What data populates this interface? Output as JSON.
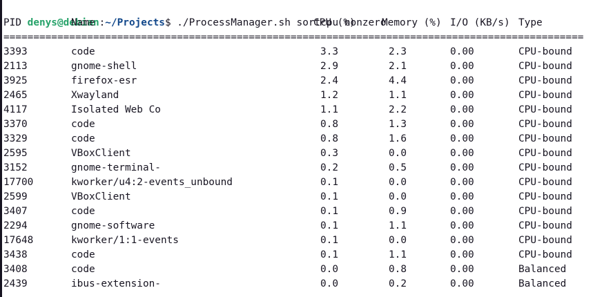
{
  "prompt": {
    "user_host": "denys@debian",
    "colon": ":",
    "path": "~/Projects",
    "symbol": "$",
    "command": " ./ProcessManager.sh sortcpu nonzero"
  },
  "table": {
    "headers": {
      "pid": "PID",
      "name": "Name",
      "cpu": "CPU (%)",
      "memory": "Memory (%)",
      "io": "I/O (KB/s)",
      "type": "Type"
    },
    "separator": "=================================================================================================",
    "rows": [
      {
        "pid": "3393",
        "name": "code",
        "cpu": "3.3",
        "mem": "2.3",
        "io": "0.00",
        "type": "CPU-bound"
      },
      {
        "pid": "2113",
        "name": "gnome-shell",
        "cpu": "2.9",
        "mem": "2.1",
        "io": "0.00",
        "type": "CPU-bound"
      },
      {
        "pid": "3925",
        "name": "firefox-esr",
        "cpu": "2.4",
        "mem": "4.4",
        "io": "0.00",
        "type": "CPU-bound"
      },
      {
        "pid": "2465",
        "name": "Xwayland",
        "cpu": "1.2",
        "mem": "1.1",
        "io": "0.00",
        "type": "CPU-bound"
      },
      {
        "pid": "4117",
        "name": "Isolated Web Co",
        "cpu": "1.1",
        "mem": "2.2",
        "io": "0.00",
        "type": "CPU-bound"
      },
      {
        "pid": "3370",
        "name": "code",
        "cpu": "0.8",
        "mem": "1.3",
        "io": "0.00",
        "type": "CPU-bound"
      },
      {
        "pid": "3329",
        "name": "code",
        "cpu": "0.8",
        "mem": "1.6",
        "io": "0.00",
        "type": "CPU-bound"
      },
      {
        "pid": "2595",
        "name": "VBoxClient",
        "cpu": "0.3",
        "mem": "0.0",
        "io": "0.00",
        "type": "CPU-bound"
      },
      {
        "pid": "3152",
        "name": "gnome-terminal-",
        "cpu": "0.2",
        "mem": "0.5",
        "io": "0.00",
        "type": "CPU-bound"
      },
      {
        "pid": "17700",
        "name": "kworker/u4:2-events_unbound",
        "cpu": "0.1",
        "mem": "0.0",
        "io": "0.00",
        "type": "CPU-bound"
      },
      {
        "pid": "2599",
        "name": "VBoxClient",
        "cpu": "0.1",
        "mem": "0.0",
        "io": "0.00",
        "type": "CPU-bound"
      },
      {
        "pid": "3407",
        "name": "code",
        "cpu": "0.1",
        "mem": "0.9",
        "io": "0.00",
        "type": "CPU-bound"
      },
      {
        "pid": "2294",
        "name": "gnome-software",
        "cpu": "0.1",
        "mem": "1.1",
        "io": "0.00",
        "type": "CPU-bound"
      },
      {
        "pid": "17648",
        "name": "kworker/1:1-events",
        "cpu": "0.1",
        "mem": "0.0",
        "io": "0.00",
        "type": "CPU-bound"
      },
      {
        "pid": "3438",
        "name": "code",
        "cpu": "0.1",
        "mem": "1.1",
        "io": "0.00",
        "type": "CPU-bound"
      },
      {
        "pid": "3408",
        "name": "code",
        "cpu": "0.0",
        "mem": "0.8",
        "io": "0.00",
        "type": "Balanced"
      },
      {
        "pid": "2439",
        "name": "ibus-extension-",
        "cpu": "0.0",
        "mem": "0.2",
        "io": "0.00",
        "type": "Balanced"
      }
    ]
  },
  "colors": {
    "background": "#ffffff",
    "foreground": "#171421",
    "user_host": "#26a269",
    "path": "#12488b"
  }
}
